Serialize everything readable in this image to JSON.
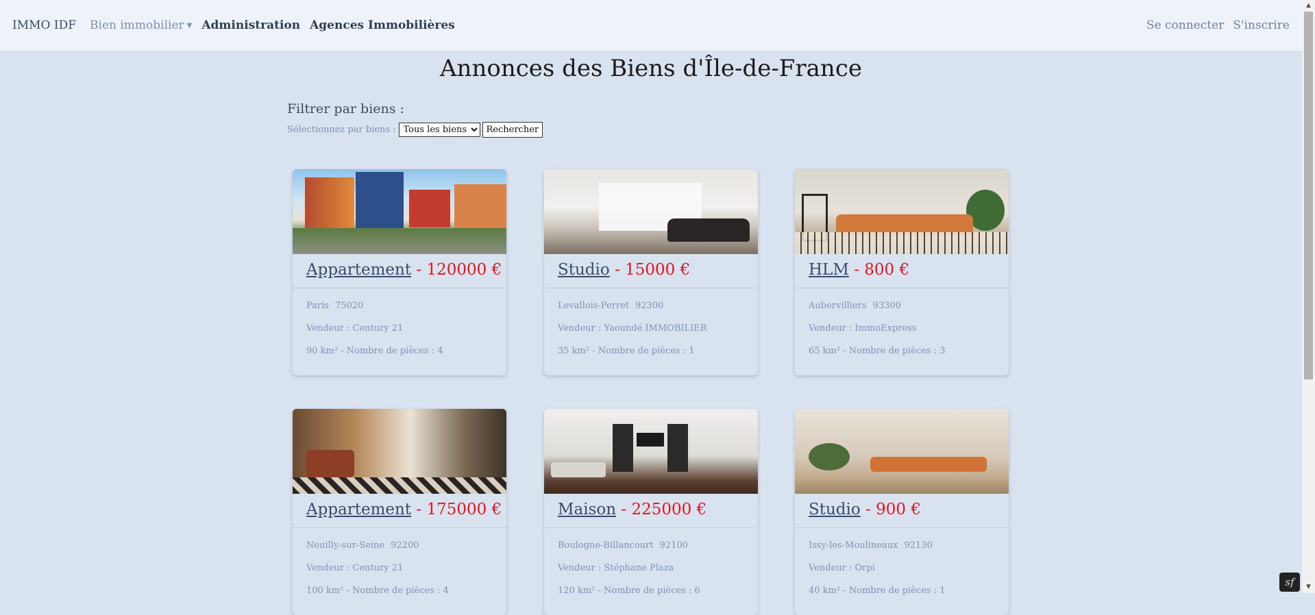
{
  "navbar": {
    "brand": "IMMO IDF",
    "dropdown_label": "Bien immobilier",
    "admin_label": "Administration",
    "agencies_label": "Agences Immobilières",
    "login_label": "Se connecter",
    "signup_label": "S'inscrire"
  },
  "page": {
    "title": "Annonces des Biens d'Île-de-France"
  },
  "filter": {
    "heading": "Filtrer par biens :",
    "select_label": "Sélectionnez par biens :",
    "selected_option": "Tous les biens",
    "button_label": "Rechercher"
  },
  "listings": [
    {
      "type": "Appartement",
      "price": "- 120000 €",
      "city": "Paris",
      "zip": "75020",
      "seller": "Vendeur : Century 21",
      "details": "90 km² - Nombre de pièces : 4"
    },
    {
      "type": "Studio",
      "price": "- 15000 €",
      "city": "Levallois-Perret",
      "zip": "92300",
      "seller": "Vendeur : Yaoundé IMMOBILIER",
      "details": "35 km² - Nombre de pièces : 1"
    },
    {
      "type": "HLM",
      "price": "- 800 €",
      "city": "Aubervilliers",
      "zip": "93300",
      "seller": "Vendeur : ImmoExpress",
      "details": "65 km² - Nombre de pièces : 3"
    },
    {
      "type": "Appartement",
      "price": "- 175000 €",
      "city": "Neuilly-sur-Seine",
      "zip": "92200",
      "seller": "Vendeur : Century 21",
      "details": "100 km² - Nombre de pièces : 4"
    },
    {
      "type": "Maison",
      "price": "- 225000 €",
      "city": "Boulogne-Billancourt",
      "zip": "92100",
      "seller": "Vendeur : Stéphane Plaza",
      "details": "120 km² - Nombre de pièces : 6"
    },
    {
      "type": "Studio",
      "price": "- 900 €",
      "city": "Issy-les-Moulineaux",
      "zip": "92130",
      "seller": "Vendeur : Orpi",
      "details": "40 km² - Nombre de pièces : 1"
    }
  ],
  "icons": {
    "caret": "caret-down-icon",
    "scroll_up": "scroll-up-arrow-icon",
    "scroll_down": "scroll-down-arrow-icon",
    "toolbar": "symfony-toolbar-icon"
  },
  "colors": {
    "page_background": "#d9e3f0",
    "navbar_background": "#eef3f9",
    "price": "#e3141f",
    "link": "#3b4a6a"
  }
}
